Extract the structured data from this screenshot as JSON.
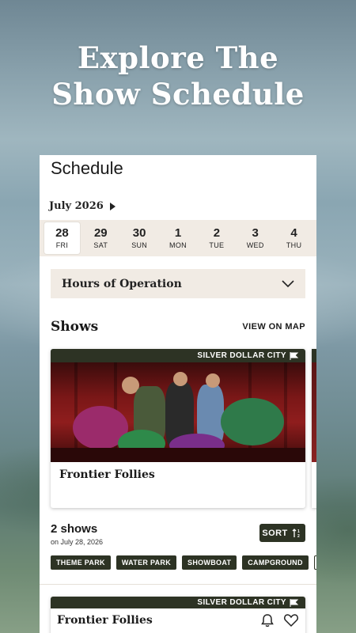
{
  "hero": {
    "line1": "Explore The",
    "line2": "Show Schedule"
  },
  "schedule": {
    "title": "Schedule",
    "month": "July 2026",
    "dates": [
      {
        "num": "28",
        "dow": "FRI",
        "active": true
      },
      {
        "num": "29",
        "dow": "SAT",
        "active": false
      },
      {
        "num": "30",
        "dow": "SUN",
        "active": false
      },
      {
        "num": "1",
        "dow": "MON",
        "active": false
      },
      {
        "num": "2",
        "dow": "TUE",
        "active": false
      },
      {
        "num": "3",
        "dow": "WED",
        "active": false
      },
      {
        "num": "4",
        "dow": "THU",
        "active": false
      }
    ],
    "hours_label": "Hours of Operation"
  },
  "shows": {
    "title": "Shows",
    "map_link": "VIEW ON MAP",
    "featured": {
      "brand": "SILVER DOLLAR CITY",
      "title": "Frontier Follies"
    }
  },
  "results": {
    "count": "2 shows",
    "date_text": "on July 28, 2026",
    "sort_label": "SORT",
    "filters": [
      "THEME PARK",
      "WATER PARK",
      "SHOWBOAT",
      "CAMPGROUND",
      "O"
    ],
    "first_item": {
      "brand": "SILVER DOLLAR CITY",
      "title": "Frontier Follies"
    }
  },
  "colors": {
    "dark_olive": "#2d3324",
    "cream": "#f1ebe4"
  }
}
